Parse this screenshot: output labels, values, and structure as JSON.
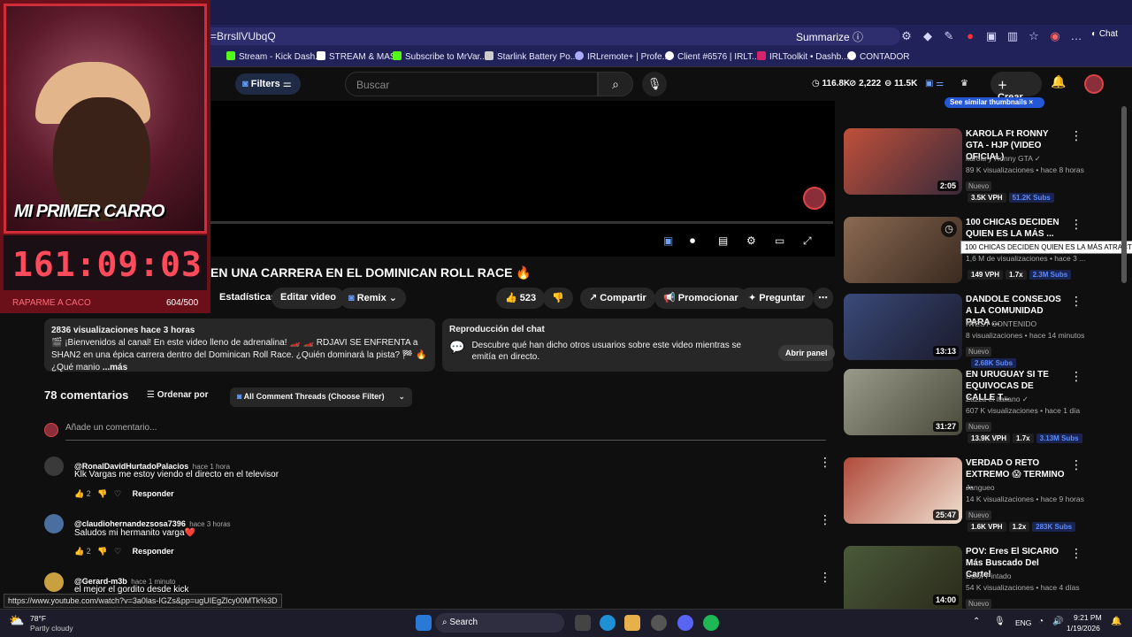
{
  "browser": {
    "url": "=BrrsllVUbqQ",
    "summarize_label": "Summarize",
    "chat_label": "Chat",
    "bookmarks": [
      {
        "label": "Stream - Kick Dash...",
        "color": "#53fc18"
      },
      {
        "label": "STREAM & MAS",
        "color": "#ffffff"
      },
      {
        "label": "Subscribe to MrVar...",
        "color": "#53fc18"
      },
      {
        "label": "Starlink Battery Po...",
        "color": "#cccccc"
      },
      {
        "label": "IRLremote+ | Profe...",
        "color": "#aaaaff"
      },
      {
        "label": "Client #6576 | IRLT...",
        "color": "#ffffff"
      },
      {
        "label": "IRLToolkit • Dashb...",
        "color": "#d6236b"
      },
      {
        "label": "CONTADOR",
        "color": "#ffffff"
      }
    ]
  },
  "header": {
    "filters_label": "Filters",
    "search_placeholder": "Buscar",
    "stats": [
      "116.8K",
      "2,222",
      "11.5K"
    ],
    "create_label": "Crear"
  },
  "overlay": {
    "banner": "MI PRIMER CARRO",
    "timer": "161:09:03",
    "goal_label": "RAPARME A CACO",
    "goal_count": "604/500"
  },
  "video": {
    "title": "EN UNA CARRERA EN EL DOMINICAN ROLL RACE 🔥",
    "actions": {
      "stats": "Estadísticas",
      "edit": "Editar video",
      "remix": "Remix",
      "likes": "523",
      "share": "Compartir",
      "promote": "Promocionar",
      "ask": "Preguntar"
    },
    "description": {
      "meta": "2836 visualizaciones  hace 3 horas",
      "text": "🎬 ¡Bienvenidos al canal! En este video lleno de adrenalina! 🏎️ 🏎️ RDJAVI SE ENFRENTA a SHAN2 en una épica carrera dentro del Dominican Roll Race. ¿Quién dominará la pista? 🏁 🔥 ¿Qué manio",
      "more": "...más"
    },
    "chat_replay": {
      "title": "Reproducción del chat",
      "text": "Descubre qué han dicho otros usuarios sobre este video mientras se emitía en directo.",
      "button": "Abrir panel"
    }
  },
  "comments": {
    "count_label": "78 comentarios",
    "sort_label": "Ordenar por",
    "filter_label": "All Comment Threads (Choose Filter)",
    "add_placeholder": "Añade un comentario...",
    "reply_label": "Responder",
    "items": [
      {
        "user": "@RonalDavidHurtadoPalacios",
        "time": "hace 1 hora",
        "text": "Klk Vargas me estoy viendo el directo en el televisor",
        "likes": "2",
        "avatar_color": "#3a3a3a"
      },
      {
        "user": "@claudiohernandezsosa7396",
        "time": "hace 3 horas",
        "text": "Saludos mi hermanito varga❤️",
        "likes": "2",
        "avatar_color": "#4a6ea0"
      },
      {
        "user": "@Gerard-m3b",
        "time": "hace 1 minuto",
        "text": "el mejor el gordito desde kick",
        "likes": "",
        "avatar_color": "#c8a040"
      }
    ]
  },
  "sidebar": {
    "similar_label": "See similar thumbnails",
    "tooltip": "100 CHICAS DECIDEN QUIEN ES LA MÁS ATRACTIVA",
    "items": [
      {
        "title": "KAROLA Ft RONNY GTA - HJP (VIDEO OFICIAL)",
        "channel": "karola y Ronny GTA ✓",
        "meta": "89 K visualizaciones • hace 8 horas",
        "badge": "Nuevo",
        "vph": "3.5K VPH",
        "ratio": "",
        "subs": "51.2K Subs",
        "duration": "2:05",
        "thumb": "#c0503a"
      },
      {
        "title": "100 CHICAS DECIDEN QUIEN ES LA MÁS ...",
        "channel": "",
        "meta": "1,6 M de visualizaciones • hace 3 ...",
        "badge": "",
        "vph": "149 VPH",
        "ratio": "1.7x",
        "subs": "2.3M Subs",
        "duration": "",
        "thumb": "#8a6a52"
      },
      {
        "title": "DANDOLE CONSEJOS A LA COMUNIDAD PARA ...",
        "channel": "IWEST CONTENIDO",
        "meta": "8 visualizaciones • hace 14 minutos",
        "badge": "Nuevo",
        "vph": "",
        "ratio": "",
        "subs": "2.68K Subs",
        "duration": "13:13",
        "thumb": "#3a4a7a"
      },
      {
        "title": "EN URUGUAY SI TE EQUIVOCAS DE CALLE T...",
        "channel": "Zazza el italiano ✓",
        "meta": "607 K visualizaciones • hace 1 día",
        "badge": "Nuevo",
        "vph": "13.9K VPH",
        "ratio": "1.7x",
        "subs": "3.13M Subs",
        "duration": "31:27",
        "thumb": "#7a7a6a"
      },
      {
        "title": "VERDAD O RETO EXTREMO 😱 TERMINO ...",
        "channel": "Jangueo",
        "meta": "14 K visualizaciones • hace 9 horas",
        "badge": "Nuevo",
        "vph": "1.6K VPH",
        "ratio": "1.2x",
        "subs": "283K Subs",
        "duration": "25:47",
        "thumb": "#b04a3a"
      },
      {
        "title": "POV: Eres El SICARIO Más Buscado Del Cartel",
        "channel": "Dolor Pintado",
        "meta": "54 K visualizaciones • hace 4 días",
        "badge": "Nuevo",
        "vph": "",
        "ratio": "",
        "subs": "",
        "duration": "14:00",
        "thumb": "#4a5a3a"
      }
    ]
  },
  "status_url": "https://www.youtube.com/watch?v=3a0las-IGZs&pp=ugUIEgZlcy00MTk%3D",
  "taskbar": {
    "temp": "78°F",
    "weather": "Partly cloudy",
    "search_label": "Search",
    "lang": "ENG",
    "time": "9:21 PM",
    "date": "1/19/2026"
  }
}
